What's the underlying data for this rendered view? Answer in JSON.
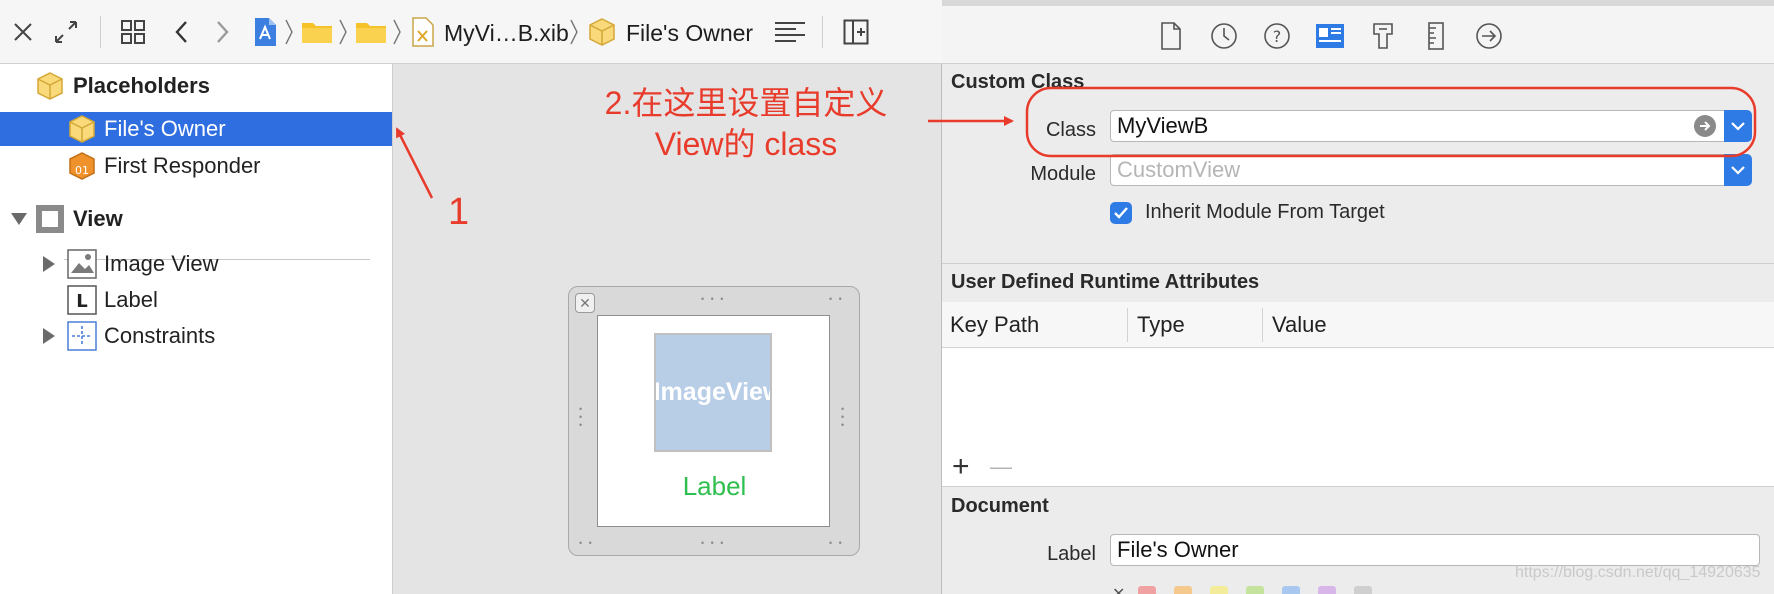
{
  "jump_bar": {
    "file_name": "MyVi…B.xib",
    "current_item": "File's Owner"
  },
  "outline": {
    "placeholders_header": "Placeholders",
    "files_owner": "File's Owner",
    "first_responder": "First Responder",
    "view": "View",
    "image_view": "Image View",
    "label": "Label",
    "constraints": "Constraints",
    "label_icon_letter": "L"
  },
  "canvas": {
    "image_view_text": "ImageView",
    "label_text": "Label"
  },
  "annotations": {
    "step1": "1",
    "step2_line1": "2.在这里设置自定义",
    "step2_line2": "View的 class",
    "color": "#e83b2b"
  },
  "inspector": {
    "custom_class": {
      "title": "Custom Class",
      "class_label": "Class",
      "class_value": "MyViewB",
      "module_label": "Module",
      "module_placeholder": "CustomView",
      "inherit_label": "Inherit Module From Target",
      "inherit_checked": true
    },
    "runtime_attributes": {
      "title": "User Defined Runtime Attributes",
      "columns": [
        "Key Path",
        "Type",
        "Value"
      ],
      "add": "+",
      "remove": "—"
    },
    "document": {
      "title": "Document",
      "label_label": "Label",
      "label_value": "File's Owner"
    },
    "swatch_colors": [
      "#f0a2a2",
      "#f5c98e",
      "#f3ec9b",
      "#c4e39c",
      "#a9c8f0",
      "#d9b6ea",
      "#cfcfcf"
    ]
  },
  "watermark": "https://blog.csdn.net/qq_14920635",
  "colors": {
    "accent": "#2f7be6",
    "selection": "#2f6ee0"
  }
}
